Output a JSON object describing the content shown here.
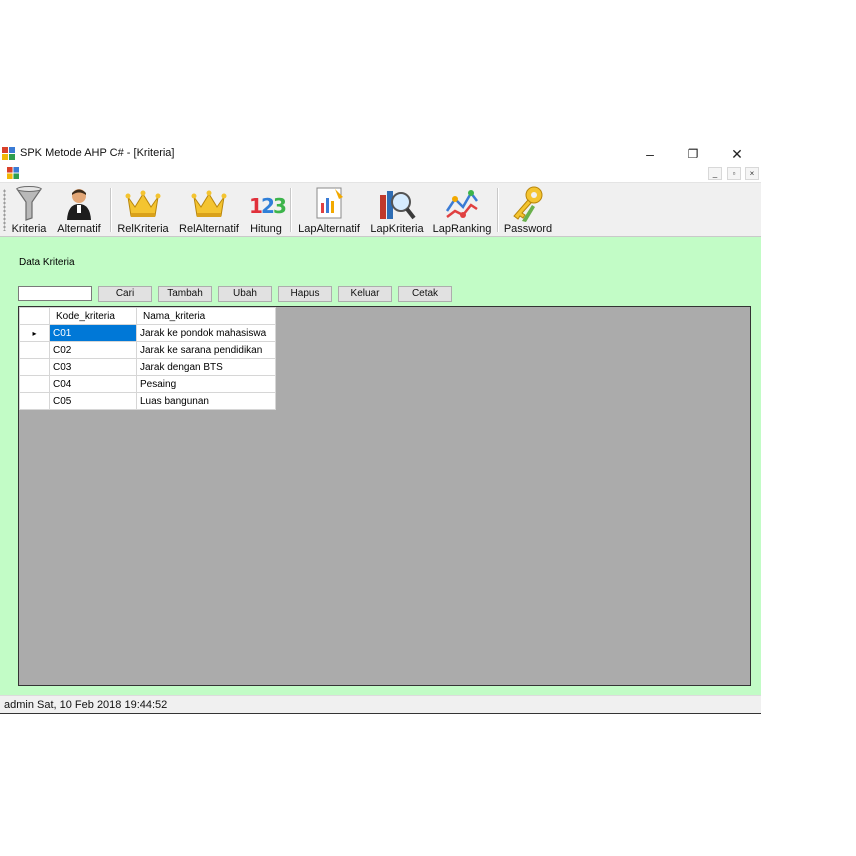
{
  "window": {
    "title": "SPK Metode AHP C# - [Kriteria]",
    "controls": {
      "minimize": "–",
      "maximize": "❐",
      "close": "✕"
    },
    "mdi_controls": {
      "minimize": "_",
      "restore": "▫",
      "close": "×"
    }
  },
  "toolbar": {
    "items": [
      {
        "label": "Kriteria",
        "icon": "funnel-icon"
      },
      {
        "label": "Alternatif",
        "icon": "user-icon"
      },
      {
        "label": "RelKriteria",
        "icon": "crown-icon"
      },
      {
        "label": "RelAlternatif",
        "icon": "crown-icon"
      },
      {
        "label": "Hitung",
        "icon": "numbers-123-icon"
      },
      {
        "label": "LapAlternatif",
        "icon": "report-chart-icon"
      },
      {
        "label": "LapKriteria",
        "icon": "magnifier-books-icon"
      },
      {
        "label": "LapRanking",
        "icon": "line-chart-icon"
      },
      {
        "label": "Password",
        "icon": "keys-icon"
      }
    ]
  },
  "form": {
    "heading": "Data Kriteria",
    "search": {
      "value": "",
      "placeholder": ""
    },
    "buttons": {
      "cari": "Cari",
      "tambah": "Tambah",
      "ubah": "Ubah",
      "hapus": "Hapus",
      "keluar": "Keluar",
      "cetak": "Cetak"
    }
  },
  "grid": {
    "columns": [
      "Kode_kriteria",
      "Nama_kriteria"
    ],
    "current_row_marker": "▸",
    "rows": [
      [
        "C01",
        "Jarak ke pondok mahasiswa"
      ],
      [
        "C02",
        "Jarak ke sarana pendidikan"
      ],
      [
        "C03",
        "Jarak dengan BTS"
      ],
      [
        "C04",
        "Pesaing"
      ],
      [
        "C05",
        "Luas bangunan"
      ]
    ]
  },
  "status": {
    "text": "admin Sat, 10 Feb 2018 19:44:52"
  },
  "colors": {
    "client_bg": "#c2fcc6",
    "grid_bg": "#ababab",
    "selection": "#0078d7"
  }
}
